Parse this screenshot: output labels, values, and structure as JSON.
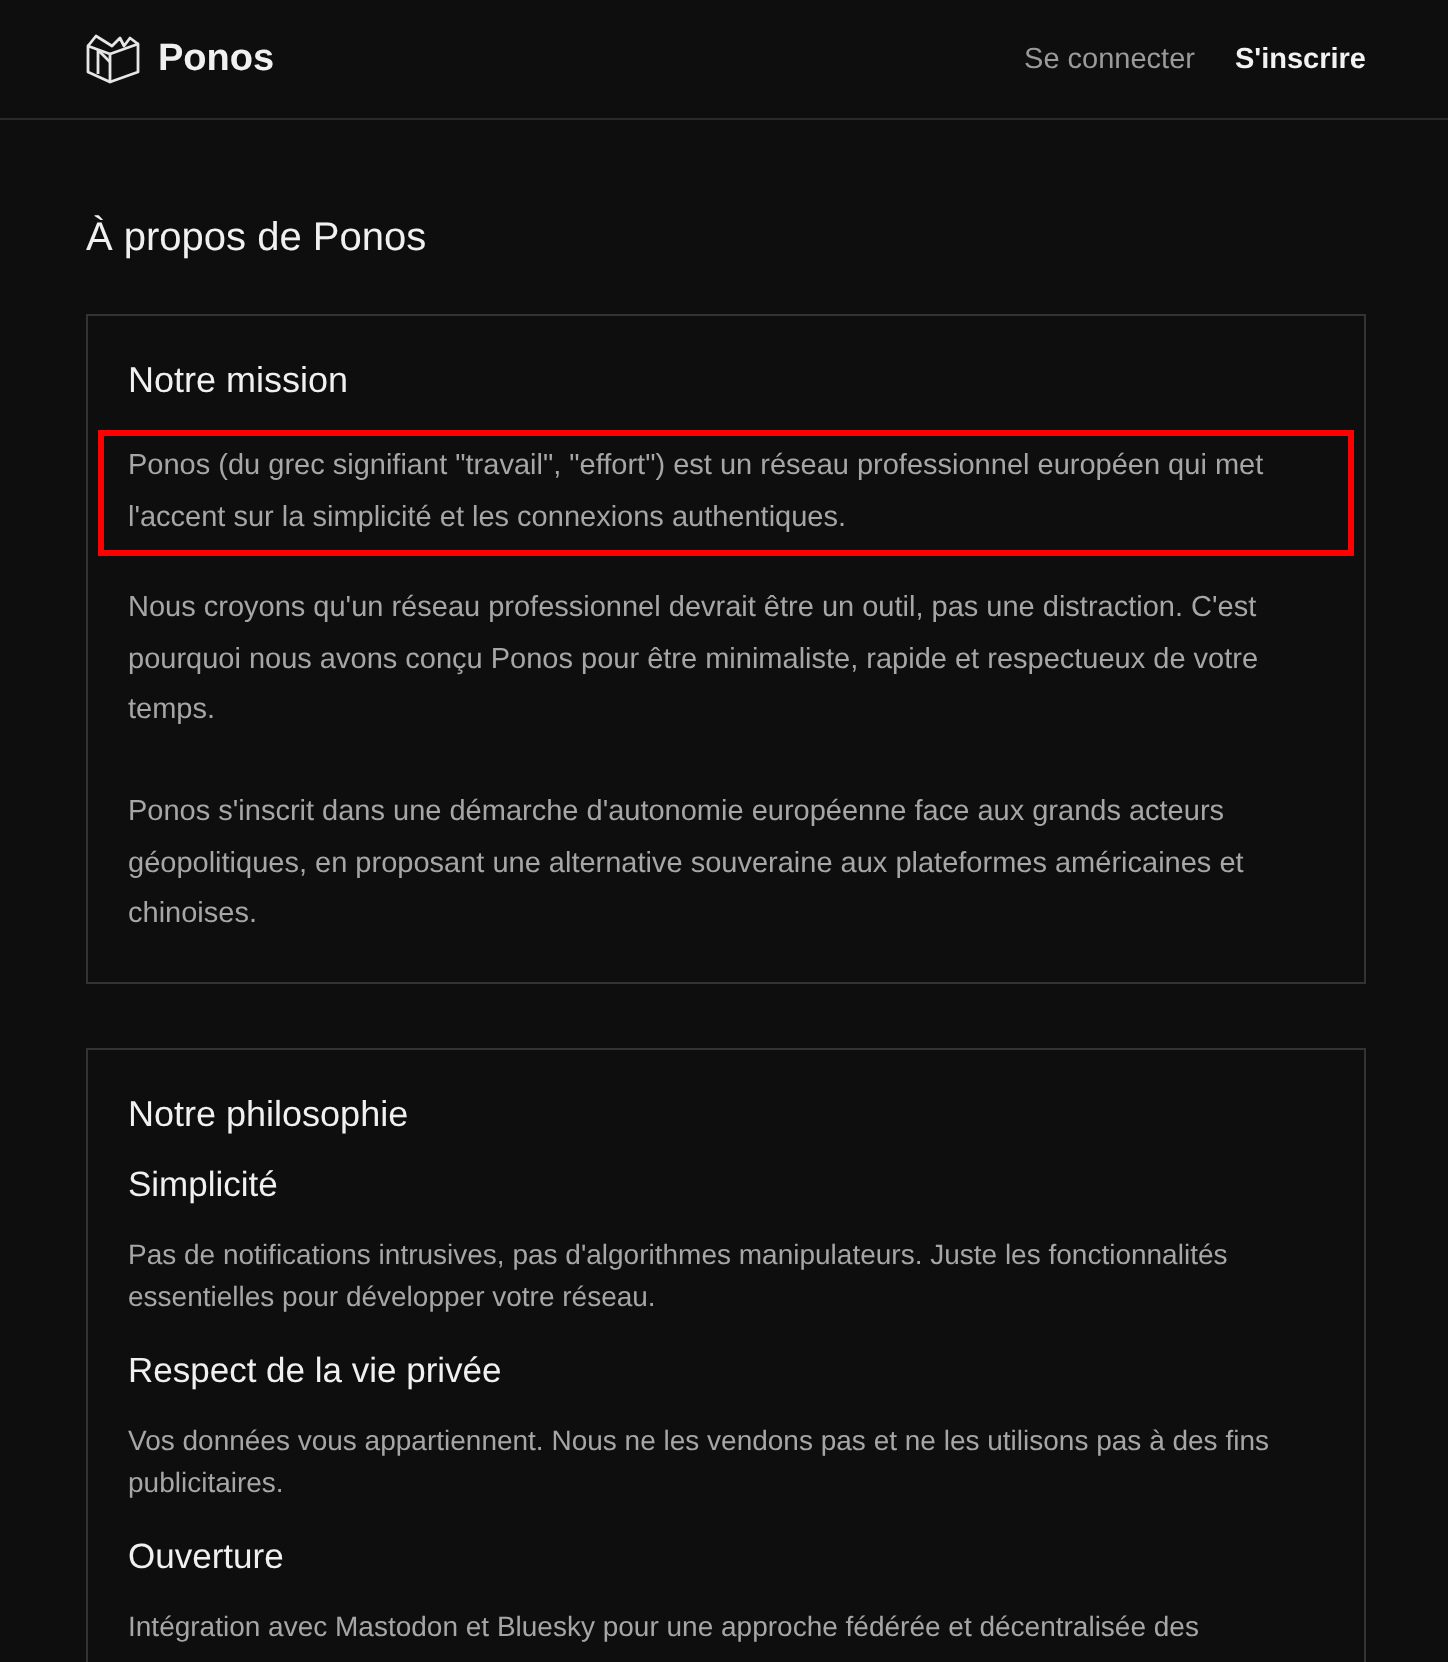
{
  "header": {
    "brand": "Ponos",
    "links": [
      {
        "label": "Se connecter",
        "kind": "secondary"
      },
      {
        "label": "S'inscrire",
        "kind": "primary"
      }
    ]
  },
  "page_title": "À propos de Ponos",
  "mission": {
    "title": "Notre mission",
    "paragraphs": [
      {
        "text": "Ponos (du grec signifiant \"travail\", \"effort\") est un réseau professionnel européen qui met l'accent sur la simplicité et les connexions authentiques.",
        "highlighted": true
      },
      {
        "text": "Nous croyons qu'un réseau professionnel devrait être un outil, pas une distraction. C'est pourquoi nous avons conçu Ponos pour être minimaliste, rapide et respectueux de votre temps.\n\nPonos s'inscrit dans une démarche d'autonomie européenne face aux grands acteurs géopolitiques, en proposant une alternative souveraine aux plateformes américaines et chinoises.",
        "highlighted": false
      }
    ]
  },
  "philosophy": {
    "title": "Notre philosophie",
    "sections": [
      {
        "title": "Simplicité",
        "text": "Pas de notifications intrusives, pas d'algorithmes manipulateurs. Juste les fonctionnalités essentielles pour développer votre réseau."
      },
      {
        "title": "Respect de la vie privée",
        "text": "Vos données vous appartiennent. Nous ne les vendons pas et ne les utilisons pas à des fins publicitaires."
      },
      {
        "title": "Ouverture",
        "text": "Intégration avec Mastodon et Bluesky pour une approche fédérée et décentralisée des"
      }
    ]
  }
}
